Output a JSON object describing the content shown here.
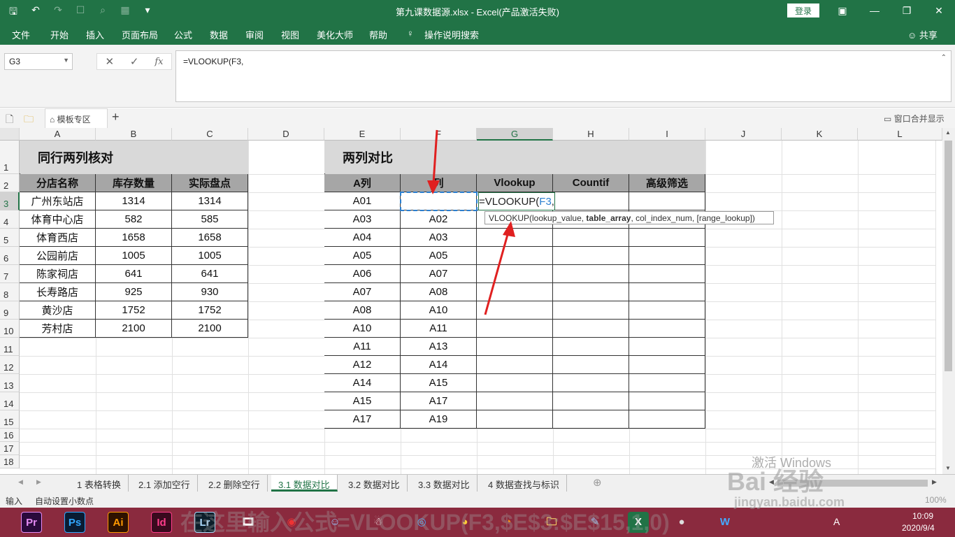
{
  "titlebar": {
    "title": "第九课数据源.xlsx  -  Excel(产品激活失败)",
    "login_label": "登录",
    "qat_icons": [
      "save-icon",
      "undo-icon",
      "redo-icon",
      "new-file-icon",
      "print-preview-icon",
      "form-icon",
      "customize-icon"
    ]
  },
  "ribbon": {
    "tabs": [
      "文件",
      "开始",
      "插入",
      "页面布局",
      "公式",
      "数据",
      "审阅",
      "视图",
      "美化大师",
      "帮助",
      "操作说明搜索"
    ],
    "share_label": "共享"
  },
  "formula_bar": {
    "name_box": "G3",
    "fx_label": "fx",
    "formula": "=VLOOKUP(F3,"
  },
  "toolstrip": {
    "template_tab": "模板专区",
    "merge_window_label": "窗口合并显示"
  },
  "columns": [
    "A",
    "B",
    "C",
    "D",
    "E",
    "F",
    "G",
    "H",
    "I",
    "J",
    "K",
    "L"
  ],
  "rows": [
    "1",
    "2",
    "3",
    "4",
    "5",
    "6",
    "7",
    "8",
    "9",
    "10",
    "11",
    "12",
    "13",
    "14",
    "15",
    "16",
    "17",
    "18"
  ],
  "table1": {
    "title": "同行两列核对",
    "headers": [
      "分店名称",
      "库存数量",
      "实际盘点"
    ],
    "rows": [
      [
        "广州东站店",
        "1314",
        "1314"
      ],
      [
        "体育中心店",
        "582",
        "585"
      ],
      [
        "体育西店",
        "1658",
        "1658"
      ],
      [
        "公园前店",
        "1005",
        "1005"
      ],
      [
        "陈家祠店",
        "641",
        "641"
      ],
      [
        "长寿路店",
        "925",
        "930"
      ],
      [
        "黄沙店",
        "1752",
        "1752"
      ],
      [
        "芳村店",
        "2100",
        "2100"
      ]
    ]
  },
  "table2": {
    "title": "两列对比",
    "headers": [
      "A列",
      "列",
      "Vlookup",
      "Countif",
      "高级筛选"
    ],
    "col_e": [
      "A01",
      "A03",
      "A04",
      "A05",
      "A06",
      "A07",
      "A08",
      "A10",
      "A11",
      "A12",
      "A14",
      "A15",
      "A17"
    ],
    "col_f": [
      "",
      "A02",
      "A03",
      "A05",
      "A07",
      "A08",
      "A10",
      "A11",
      "A13",
      "A14",
      "A15",
      "A17",
      "A19"
    ]
  },
  "edit_cell": {
    "prefix": "=VLOOKUP(",
    "ref": "F3",
    "suffix": ","
  },
  "tooltip": {
    "fn": "VLOOKUP(",
    "arg1": "lookup_value, ",
    "arg2_bold": "table_array",
    "rest": ", col_index_num, [range_lookup])"
  },
  "sheet_tabs": [
    "1 表格转换",
    "2.1 添加空行",
    "2.2 删除空行",
    "3.1 数据对比",
    "3.2 数据对比",
    "3.3 数据对比",
    "4 数据查找与标识"
  ],
  "active_sheet": "3.1 数据对比",
  "status": {
    "mode": "输入",
    "info": "自动设置小数点",
    "zoom": "100%"
  },
  "taskbar": {
    "apps": [
      "Pr",
      "Ps",
      "Ai",
      "Id",
      "Lr"
    ],
    "time": "10:09",
    "date": "2020/9/4",
    "ime": "A"
  },
  "overlay": {
    "activate_windows": "激活 Windows",
    "baidu": "Bai 经验",
    "jingyan_url": "jingyan.baidu.com",
    "caption": "在这里输入公式=VLOOKUP(F3,$E$3:$E$15,1,0)"
  },
  "colors": {
    "excel_green": "#217346",
    "header_gray": "#a6a6a6",
    "title_gray": "#d9d9d9",
    "taskbar": "#8a2a3e",
    "arrow_red": "#e02020"
  }
}
